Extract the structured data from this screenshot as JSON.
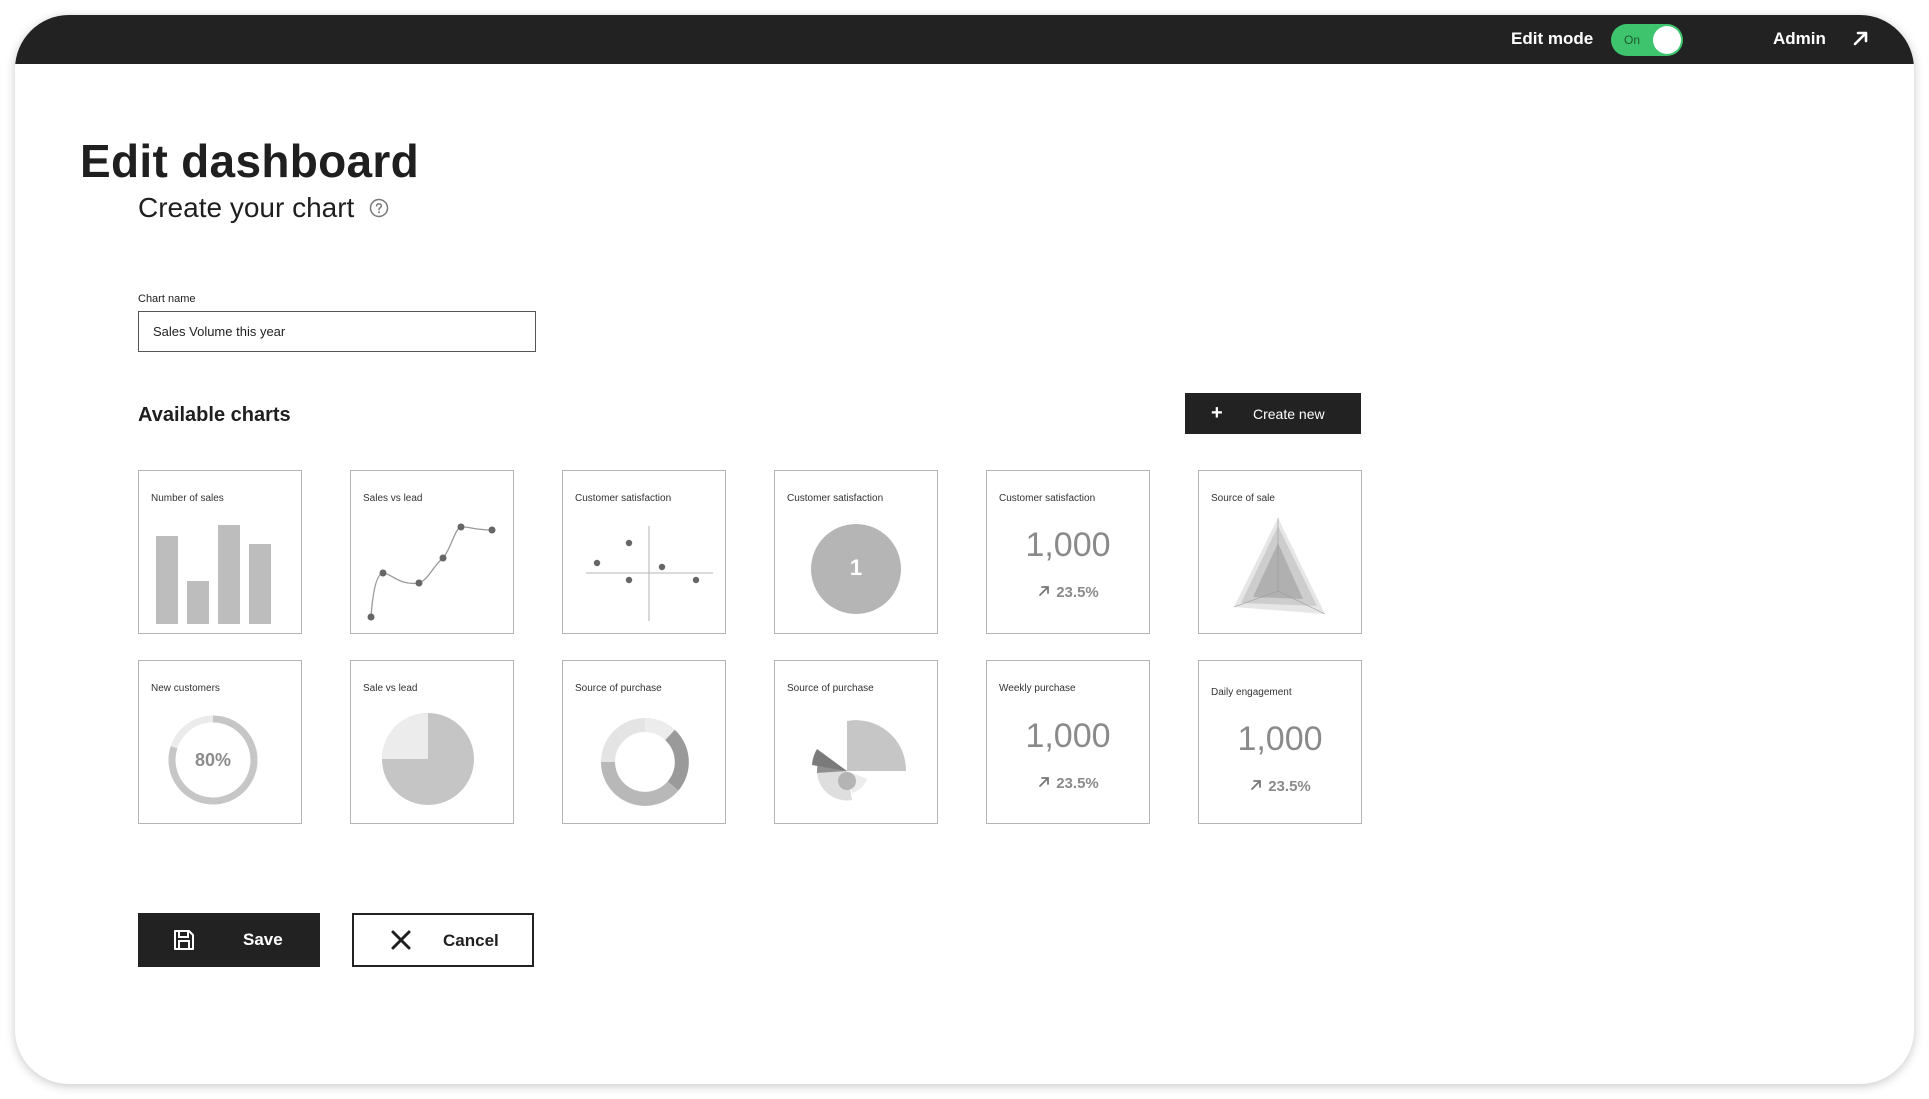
{
  "topbar": {
    "edit_mode_label": "Edit mode",
    "toggle_state": "On",
    "user_label": "Admin",
    "user_icon": "arrow-up-right-icon",
    "toggle_color": "#3ec46d"
  },
  "header": {
    "title": "Edit dashboard",
    "subtitle": "Create your chart",
    "help_icon": "help-circle-icon"
  },
  "form": {
    "chart_name_label": "Chart name",
    "chart_name_value": "Sales Volume this year"
  },
  "charts_section": {
    "heading": "Available charts",
    "create_new_label": "Create new",
    "create_new_icon": "plus-icon",
    "cards": [
      {
        "title": "Number of sales",
        "type": "bar"
      },
      {
        "title": "Sales vs lead",
        "type": "line"
      },
      {
        "title": "Customer satisfaction",
        "type": "scatter"
      },
      {
        "title": "Customer satisfaction",
        "type": "single-value",
        "value": "1"
      },
      {
        "title": "Customer satisfaction",
        "type": "kpi",
        "value": "1,000",
        "delta": "23.5%"
      },
      {
        "title": "Source of sale",
        "type": "radar"
      },
      {
        "title": "New customers",
        "type": "progress-ring",
        "value": "80%"
      },
      {
        "title": "Sale vs lead",
        "type": "pie"
      },
      {
        "title": "Source of purchase",
        "type": "donut"
      },
      {
        "title": "Source of purchase",
        "type": "polar-area"
      },
      {
        "title": "Weekly purchase",
        "type": "kpi",
        "value": "1,000",
        "delta": "23.5%"
      },
      {
        "title": "Daily engagement",
        "type": "kpi",
        "value": "1,000",
        "delta": "23.5%"
      }
    ]
  },
  "actions": {
    "save_label": "Save",
    "save_icon": "floppy-disk-icon",
    "cancel_label": "Cancel",
    "cancel_icon": "close-icon"
  }
}
